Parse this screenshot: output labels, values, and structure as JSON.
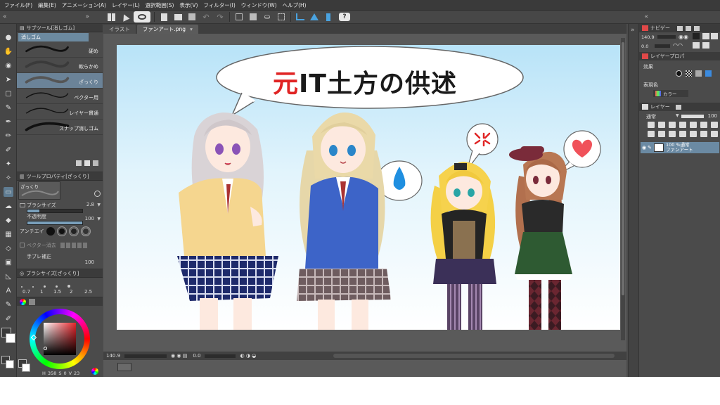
{
  "menu": [
    "ファイル(F)",
    "編集(E)",
    "アニメーション(A)",
    "レイヤー(L)",
    "選択範囲(S)",
    "表示(V)",
    "フィルター(I)",
    "ウィンドウ(W)",
    "ヘルプ(H)"
  ],
  "subtool": {
    "header": "サブツール[消しゴム]",
    "tab": "消しゴム",
    "brushes": [
      "硬め",
      "軟らかめ",
      "ざっくり",
      "ベクター用",
      "レイヤー貫通",
      "スナップ消しゴム"
    ],
    "selected_index": 2
  },
  "toolprop": {
    "header": "ツールプロパティ[ざっくり]",
    "preset_label": "ざっくり",
    "brush_size_label": "ブラシサイズ",
    "brush_size_value": "2.8",
    "opacity_label": "不透明度",
    "opacity_value": "100",
    "aa_label": "アンチエイ",
    "vector_label": "ベクター消去",
    "stabilize_label": "手ブレ補正",
    "stabilize_value": "100"
  },
  "brushsize": {
    "header": "ブラシサイズ[ざっくり]",
    "sizes": [
      "0.7",
      "1",
      "1.5",
      "2",
      "2.5"
    ]
  },
  "colorpanel": {
    "readout": [
      "H",
      "358",
      "S",
      "0",
      "V",
      "23"
    ],
    "main_color": "#3a3a3a"
  },
  "canvas": {
    "tabs": [
      "イラスト",
      "ファンアート.png"
    ],
    "active_tab": 1,
    "title_red": "元",
    "title_black": "IT土方の供述",
    "zoom": "140.9",
    "angle": "0.0"
  },
  "right": {
    "navigator_label": "ナビゲー",
    "zoom": "140.9",
    "angle": "0.0",
    "layer_prop_label": "レイヤープロパ",
    "effect_label": "効果",
    "display_color_label": "表現色",
    "display_color_value": "カラー",
    "layer_label": "レイヤー",
    "blend_mode": "通常",
    "opacity_value": "100",
    "layer_item_line1": "100 %通常",
    "layer_item_line2": "ファンアート"
  },
  "colors": {
    "accent": "#6b8aa3",
    "title_red": "#e02424"
  }
}
